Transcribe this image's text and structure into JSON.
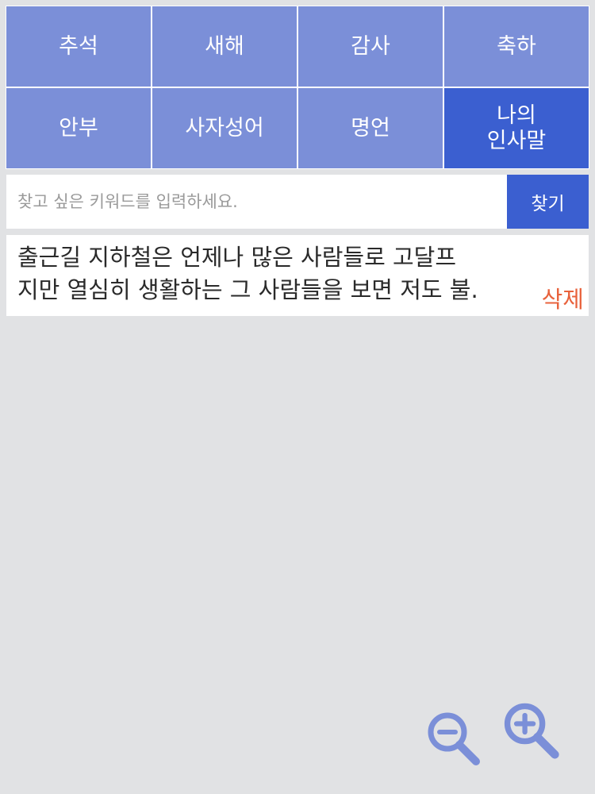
{
  "categories": [
    {
      "label": "추석",
      "active": false
    },
    {
      "label": "새해",
      "active": false
    },
    {
      "label": "감사",
      "active": false
    },
    {
      "label": "축하",
      "active": false
    },
    {
      "label": "안부",
      "active": false
    },
    {
      "label": "사자성어",
      "active": false
    },
    {
      "label": "명언",
      "active": false
    },
    {
      "label": "나의\n인사말",
      "active": true
    }
  ],
  "search": {
    "placeholder": "찾고 싶은 키워드를 입력하세요.",
    "value": "",
    "button_label": "찾기"
  },
  "message": {
    "line1": "출근길 지하철은 언제나 많은 사람들로 고달프",
    "line2": "지만 열심히 생활하는 그 사람들을 보면 저도 불.",
    "delete_label": "삭제"
  },
  "zoom": {
    "out_icon": "zoom-out-icon",
    "in_icon": "zoom-in-icon"
  },
  "colors": {
    "background": "#e1e2e4",
    "tile": "#7b8fd8",
    "tile_active": "#3b5fd0",
    "accent": "#3b5fd0",
    "delete": "#e8623c",
    "zoom_icon": "#7b8fd8"
  }
}
